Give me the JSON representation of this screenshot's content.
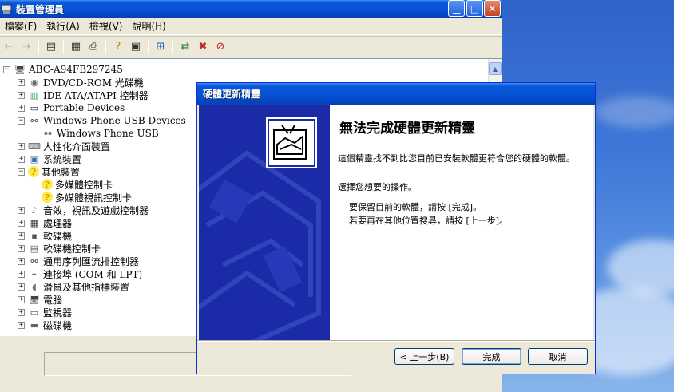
{
  "device_manager": {
    "title": "裝置管理員",
    "menu": [
      "檔案(F)",
      "執行(A)",
      "檢視(V)",
      "說明(H)"
    ],
    "tree": [
      {
        "label": "ABC-A94FB297245",
        "icon": "computer-icon",
        "level": 0,
        "expander": "−"
      },
      {
        "label": "DVD/CD-ROM 光碟機",
        "icon": "cdrom-icon",
        "level": 1,
        "expander": "+"
      },
      {
        "label": "IDE ATA/ATAPI 控制器",
        "icon": "ide-controller-icon",
        "level": 1,
        "expander": "+"
      },
      {
        "label": "Portable Devices",
        "icon": "portable-device-icon",
        "level": 1,
        "expander": "+"
      },
      {
        "label": "Windows Phone USB Devices",
        "icon": "usb-icon",
        "level": 1,
        "expander": "−"
      },
      {
        "label": "Windows Phone USB",
        "icon": "usb-icon",
        "level": 2,
        "expander": ""
      },
      {
        "label": "人性化介面裝置",
        "icon": "hid-icon",
        "level": 1,
        "expander": "+"
      },
      {
        "label": "系統裝置",
        "icon": "system-device-icon",
        "level": 1,
        "expander": "+"
      },
      {
        "label": "其他裝置",
        "icon": "unknown-device-icon",
        "level": 1,
        "expander": "−"
      },
      {
        "label": "多媒體控制卡",
        "icon": "unknown-device-icon",
        "level": 2,
        "expander": ""
      },
      {
        "label": "多媒體視訊控制卡",
        "icon": "unknown-device-icon",
        "level": 2,
        "expander": ""
      },
      {
        "label": "音效，視訊及遊戲控制器",
        "icon": "sound-icon",
        "level": 1,
        "expander": "+"
      },
      {
        "label": "處理器",
        "icon": "processor-icon",
        "level": 1,
        "expander": "+"
      },
      {
        "label": "軟碟機",
        "icon": "floppy-icon",
        "level": 1,
        "expander": "+"
      },
      {
        "label": "軟碟機控制卡",
        "icon": "floppy-controller-icon",
        "level": 1,
        "expander": "+"
      },
      {
        "label": "通用序列匯流排控制器",
        "icon": "usb-icon",
        "level": 1,
        "expander": "+"
      },
      {
        "label": "連接埠 (COM 和 LPT)",
        "icon": "port-icon",
        "level": 1,
        "expander": "+"
      },
      {
        "label": "滑鼠及其他指標裝置",
        "icon": "mouse-icon",
        "level": 1,
        "expander": "+"
      },
      {
        "label": "電腦",
        "icon": "computer-icon",
        "level": 1,
        "expander": "+"
      },
      {
        "label": "監視器",
        "icon": "monitor-icon",
        "level": 1,
        "expander": "+"
      },
      {
        "label": "磁碟機",
        "icon": "disk-icon",
        "level": 1,
        "expander": "+"
      }
    ]
  },
  "wizard": {
    "title": "硬體更新精靈",
    "heading": "無法完成硬體更新精靈",
    "message": "這個精靈找不到比您目前已安裝軟體更符合您的硬體的軟體。",
    "prompt": "選擇您想要的操作。",
    "option1": "要保留目前的軟體，請按 [完成]。",
    "option2": "若要再在其他位置搜尋，請按 [上一步]。",
    "back_label": "< 上一步(B)",
    "finish_label": "完成",
    "cancel_label": "取消"
  }
}
